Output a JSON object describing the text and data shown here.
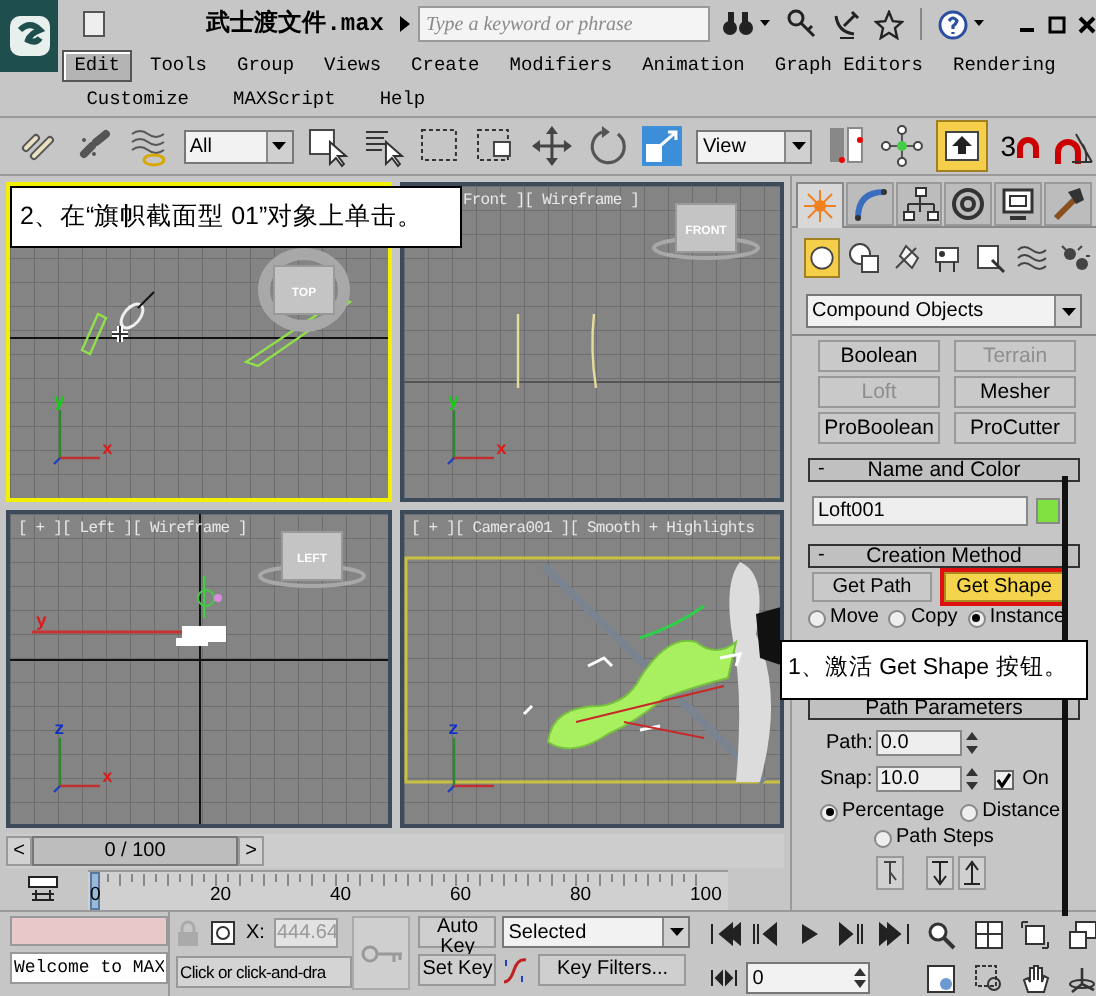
{
  "title_bar": {
    "file_name": "武士渡文件.max",
    "search": {
      "placeholder": "Type a keyword or phrase"
    }
  },
  "menu_rows": [
    [
      {
        "label": "Edit",
        "selected": true
      },
      {
        "label": "Tools",
        "selected": false
      },
      {
        "label": "Group",
        "selected": false
      },
      {
        "label": "Views",
        "selected": false
      },
      {
        "label": "Create",
        "selected": false
      },
      {
        "label": "Modifiers",
        "selected": false
      },
      {
        "label": "Animation",
        "selected": false
      },
      {
        "label": "Graph Editors",
        "selected": false
      },
      {
        "label": "Rendering",
        "selected": false
      }
    ],
    [
      {
        "label": "Customize",
        "selected": false
      },
      {
        "label": "MAXScript",
        "selected": false
      },
      {
        "label": "Help",
        "selected": false
      }
    ]
  ],
  "main_toolbar": {
    "selection_filter": "All",
    "coordinate_system": "View",
    "snap_label": "3",
    "toggle_active": true
  },
  "viewports": [
    {
      "kind": "top",
      "active": true,
      "view_cube": "TOP",
      "axes": {
        "up": "y",
        "right": "x"
      }
    },
    {
      "kind": "front",
      "active": false,
      "label": "Front ][ Wireframe ]",
      "view_cube": "FRONT",
      "axes": {
        "up": "y",
        "right": "x"
      }
    },
    {
      "kind": "left",
      "active": false,
      "label": "[ + ][ Left ][ Wireframe ]",
      "view_cube": "LEFT",
      "axes": {
        "up": "z",
        "right": "x",
        "left": "y"
      }
    },
    {
      "kind": "camera",
      "active": false,
      "label": "[ + ][ Camera001 ][ Smooth + Highlights",
      "axes": {
        "up": "z"
      }
    }
  ],
  "callouts": [
    {
      "text": "2、在“旗帜截面型 01”对象上单击。"
    },
    {
      "text": "1、激活 Get Shape 按钮。"
    }
  ],
  "time_slider": {
    "back": "<",
    "frame": "0 / 100",
    "forward": ">",
    "level": 0
  },
  "track_bar": {
    "ticks": [
      "0",
      "20",
      "40",
      "60",
      "80",
      "100"
    ]
  },
  "command_panel": {
    "tabs": [
      {
        "selected": true
      },
      {
        "selected": false
      },
      {
        "selected": false
      },
      {
        "selected": false
      },
      {
        "selected": false
      },
      {
        "selected": false
      }
    ],
    "categories": [
      {
        "selected": true
      },
      {
        "selected": false
      },
      {
        "selected": false
      },
      {
        "selected": false
      },
      {
        "selected": false
      },
      {
        "selected": false
      },
      {
        "selected": false
      }
    ],
    "dropdown": "Compound Objects",
    "object_types": [
      {
        "label": "Boolean",
        "disabled": false
      },
      {
        "label": "Terrain",
        "disabled": true
      },
      {
        "label": "Loft",
        "disabled": true
      },
      {
        "label": "Mesher",
        "disabled": false
      },
      {
        "label": "ProBoolean",
        "disabled": false
      },
      {
        "label": "ProCutter",
        "disabled": false
      }
    ],
    "name_and_color": {
      "toggle": "-",
      "title": "Name and Color",
      "name": "Loft001",
      "color": "#7fe040"
    },
    "creation_method": {
      "toggle": "-",
      "title": "Creation Method",
      "buttons": [
        {
          "label": "Get Path",
          "selected": false,
          "highlighted": false
        },
        {
          "label": "Get Shape",
          "selected": true,
          "highlighted": true
        }
      ],
      "options": [
        {
          "label": "Move",
          "selected": false
        },
        {
          "label": "Copy",
          "selected": false
        },
        {
          "label": "Instance",
          "selected": true
        }
      ]
    },
    "path_parameters": {
      "title": "Path Parameters",
      "path": {
        "label": "Path:",
        "value": "0.0"
      },
      "snap": {
        "label": "Snap:",
        "value": "10.0"
      },
      "snap_on": {
        "label": "On",
        "checked": true
      },
      "modes": [
        {
          "label": "Percentage",
          "selected": true
        },
        {
          "label": "Distance",
          "selected": false
        },
        {
          "label": "Path Steps",
          "selected": false
        }
      ]
    }
  },
  "status_bar": {
    "listener": "Welcome to MAX",
    "x_label": "X:",
    "x_value": "444.64",
    "prompt": "Click or click-and-dra",
    "auto_key": {
      "label": "Auto Key",
      "on": false
    },
    "set_key": "Set Key",
    "key_mode": "Selected",
    "key_filters": "Key Filters...",
    "frame": "0"
  }
}
